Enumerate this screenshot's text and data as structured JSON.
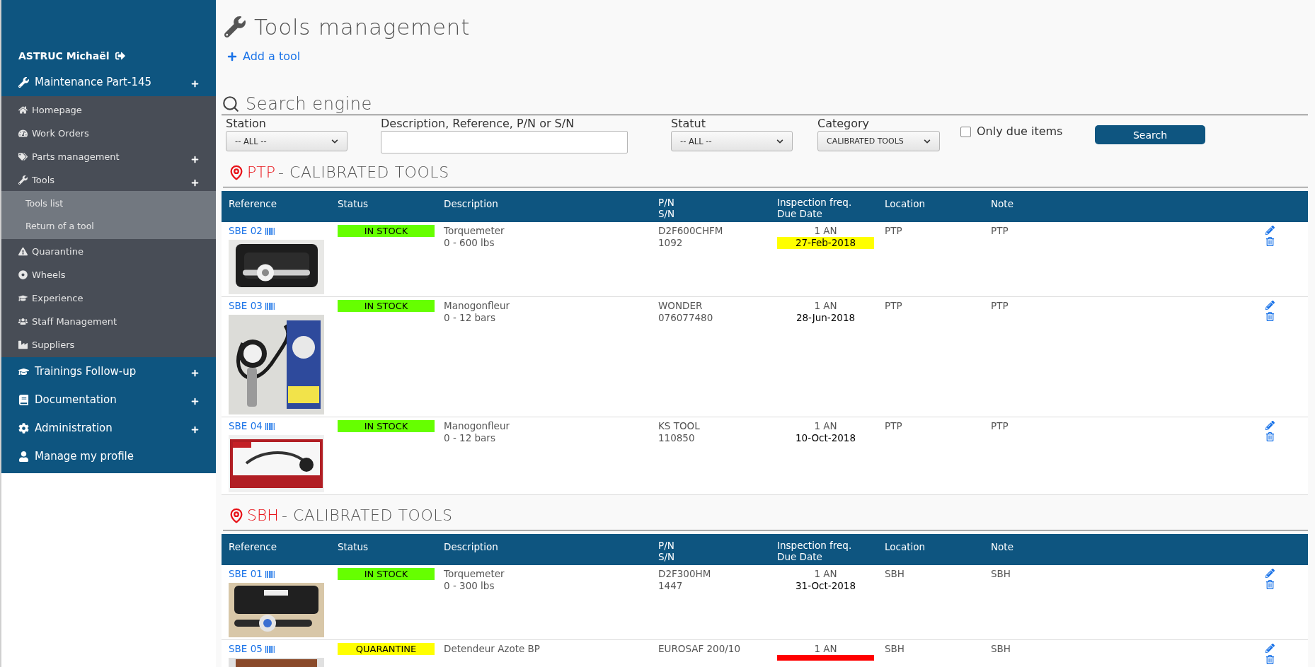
{
  "sidebar": {
    "user": "ASTRUC Michaël",
    "groups": [
      {
        "label": "Maintenance Part-145",
        "expandable": true,
        "items": [
          {
            "label": "Homepage",
            "expandable": false
          },
          {
            "label": "Work Orders",
            "expandable": false
          },
          {
            "label": "Parts management",
            "expandable": true
          },
          {
            "label": "Tools",
            "expandable": true,
            "children": [
              {
                "label": "Tools list"
              },
              {
                "label": "Return of a tool"
              }
            ]
          },
          {
            "label": "Quarantine",
            "expandable": false
          },
          {
            "label": "Wheels",
            "expandable": false
          },
          {
            "label": "Experience",
            "expandable": false
          },
          {
            "label": "Staff Management",
            "expandable": false
          },
          {
            "label": "Suppliers",
            "expandable": false
          }
        ]
      },
      {
        "label": "Trainings Follow-up",
        "expandable": true
      },
      {
        "label": "Documentation",
        "expandable": true
      },
      {
        "label": "Administration",
        "expandable": true
      },
      {
        "label": "Manage my profile",
        "expandable": false
      }
    ]
  },
  "page": {
    "title": "Tools management",
    "add_link": "Add a tool"
  },
  "search": {
    "title": "Search engine",
    "station": {
      "label": "Station",
      "value": "-- ALL --"
    },
    "text": {
      "label": "Description, Reference, P/N or S/N"
    },
    "statut": {
      "label": "Statut",
      "value": "-- ALL --"
    },
    "category": {
      "label": "Category",
      "value": "CALIBRATED TOOLS"
    },
    "only_due": {
      "label": "Only due items",
      "checked": false
    },
    "button": "Search"
  },
  "sections": [
    {
      "station": "PTP",
      "title": "- CALIBRATED TOOLS",
      "columns": [
        "Reference",
        "Status",
        "Description",
        "P/N",
        "S/N",
        "Inspection freq.",
        "Due Date",
        "Location",
        "Note"
      ],
      "rows": [
        {
          "ref": "SBE 02",
          "status": {
            "label": "IN STOCK",
            "color": "#66ff00"
          },
          "description": [
            "Torquemeter",
            "0 - 600 lbs"
          ],
          "pn": "D2F600CHFM",
          "sn": "1092",
          "freq": "1 AN",
          "due": {
            "text": "27-Feb-2018",
            "color": "#ffff00"
          },
          "location": "PTP",
          "note": "PTP"
        },
        {
          "ref": "SBE 03",
          "status": {
            "label": "IN STOCK",
            "color": "#66ff00"
          },
          "description": [
            "Manogonfleur",
            "0 - 12 bars"
          ],
          "pn": "WONDER",
          "sn": "076077480",
          "freq": "1 AN",
          "due": {
            "text": "28-Jun-2018"
          },
          "location": "PTP",
          "note": "PTP"
        },
        {
          "ref": "SBE 04",
          "status": {
            "label": "IN STOCK",
            "color": "#66ff00"
          },
          "description": [
            "Manogonfleur",
            "0 - 12 bars"
          ],
          "pn": "KS TOOL",
          "sn": "110850",
          "freq": "1 AN",
          "due": {
            "text": "10-Oct-2018"
          },
          "location": "PTP",
          "note": "PTP"
        }
      ]
    },
    {
      "station": "SBH",
      "title": "- CALIBRATED TOOLS",
      "columns": [
        "Reference",
        "Status",
        "Description",
        "P/N",
        "S/N",
        "Inspection freq.",
        "Due Date",
        "Location",
        "Note"
      ],
      "rows": [
        {
          "ref": "SBE 01",
          "status": {
            "label": "IN STOCK",
            "color": "#66ff00"
          },
          "description": [
            "Torquemeter",
            "0 - 300 lbs"
          ],
          "pn": "D2F300HM",
          "sn": "1447",
          "freq": "1 AN",
          "due": {
            "text": "31-Oct-2018"
          },
          "location": "SBH",
          "note": "SBH"
        },
        {
          "ref": "SBE 05",
          "status": {
            "label": "QUARANTINE",
            "color": "#ffff00"
          },
          "description": [
            "Detendeur Azote BP"
          ],
          "pn": "EUROSAF 200/10",
          "freq": "1 AN",
          "due": {
            "color": "#ff0000"
          },
          "location": "SBH",
          "note": "SBH"
        }
      ]
    }
  ]
}
